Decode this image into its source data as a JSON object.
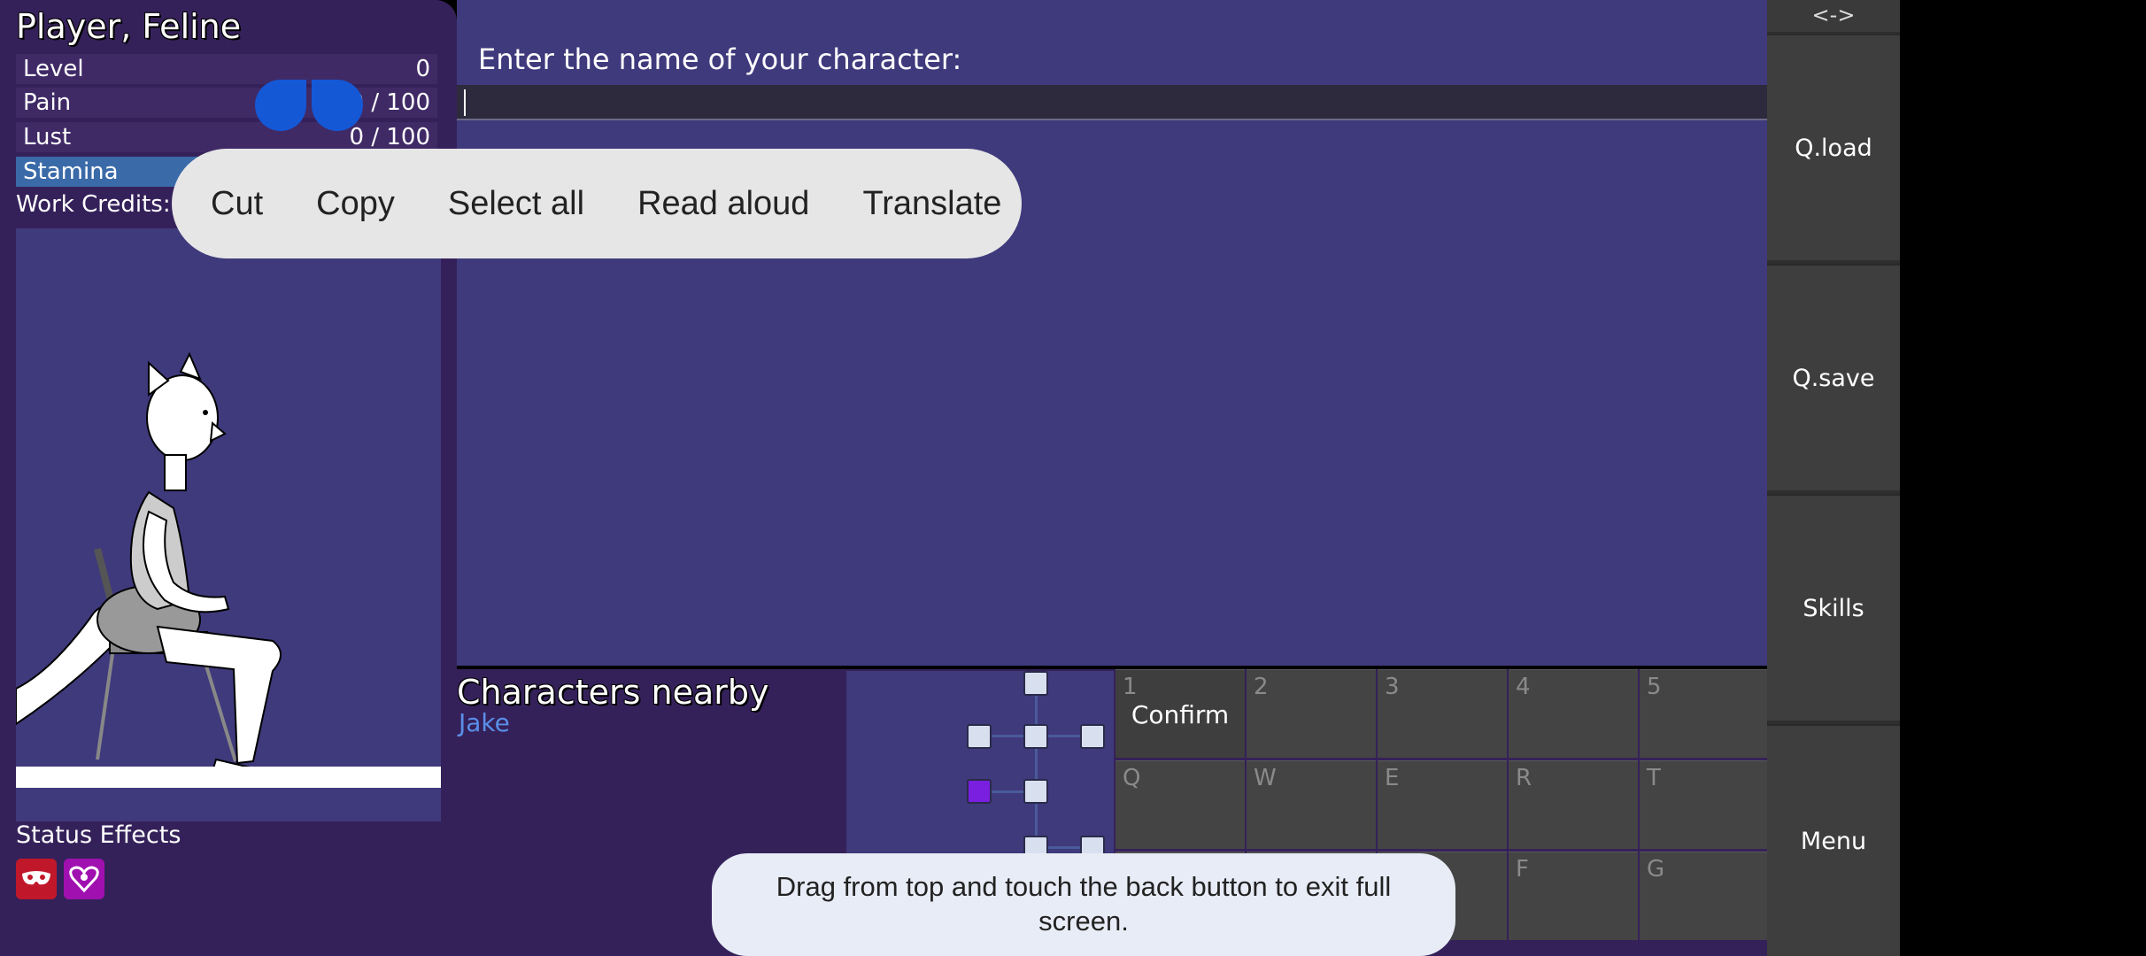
{
  "player": {
    "name": "Player, Feline",
    "stats": {
      "level": {
        "label": "Level",
        "value": "0"
      },
      "pain": {
        "label": "Pain",
        "value": "0 / 100"
      },
      "lust": {
        "label": "Lust",
        "value": "0 / 100"
      },
      "stamina": {
        "label": "Stamina",
        "value": "",
        "fill_fraction": 1.0
      }
    },
    "work_credits": "Work Credits: 0",
    "status_effects_label": "Status Effects",
    "status_effect_icons": [
      "mask-icon",
      "heart-sigil-icon"
    ]
  },
  "main": {
    "prompt": "Enter the name of your character:",
    "name_value": ""
  },
  "nearby": {
    "title": "Characters nearby",
    "names": [
      "Jake"
    ]
  },
  "grid": {
    "rows": [
      [
        {
          "key": "1",
          "label": "Confirm"
        },
        {
          "key": "2",
          "label": ""
        },
        {
          "key": "3",
          "label": ""
        },
        {
          "key": "4",
          "label": ""
        },
        {
          "key": "5",
          "label": ""
        }
      ],
      [
        {
          "key": "Q",
          "label": ""
        },
        {
          "key": "W",
          "label": ""
        },
        {
          "key": "E",
          "label": ""
        },
        {
          "key": "R",
          "label": ""
        },
        {
          "key": "T",
          "label": ""
        }
      ],
      [
        {
          "key": "",
          "label": ""
        },
        {
          "key": "",
          "label": ""
        },
        {
          "key": "",
          "label": ""
        },
        {
          "key": "F",
          "label": ""
        },
        {
          "key": "G",
          "label": ""
        }
      ]
    ]
  },
  "sidebar": {
    "toggle": "<->",
    "buttons": [
      "Q.load",
      "Q.save",
      "Skills",
      "Menu"
    ]
  },
  "context_menu": {
    "items": [
      "Cut",
      "Copy",
      "Select all",
      "Read aloud",
      "Translate"
    ]
  },
  "toast": {
    "message": "Drag from top and touch the back button to exit full screen."
  },
  "colors": {
    "panel_bg": "#35215a",
    "main_bg": "#3f3a7c",
    "handle": "#1558d6",
    "nearby_name": "#5a8ee8",
    "current_room": "#7a1ee0"
  }
}
